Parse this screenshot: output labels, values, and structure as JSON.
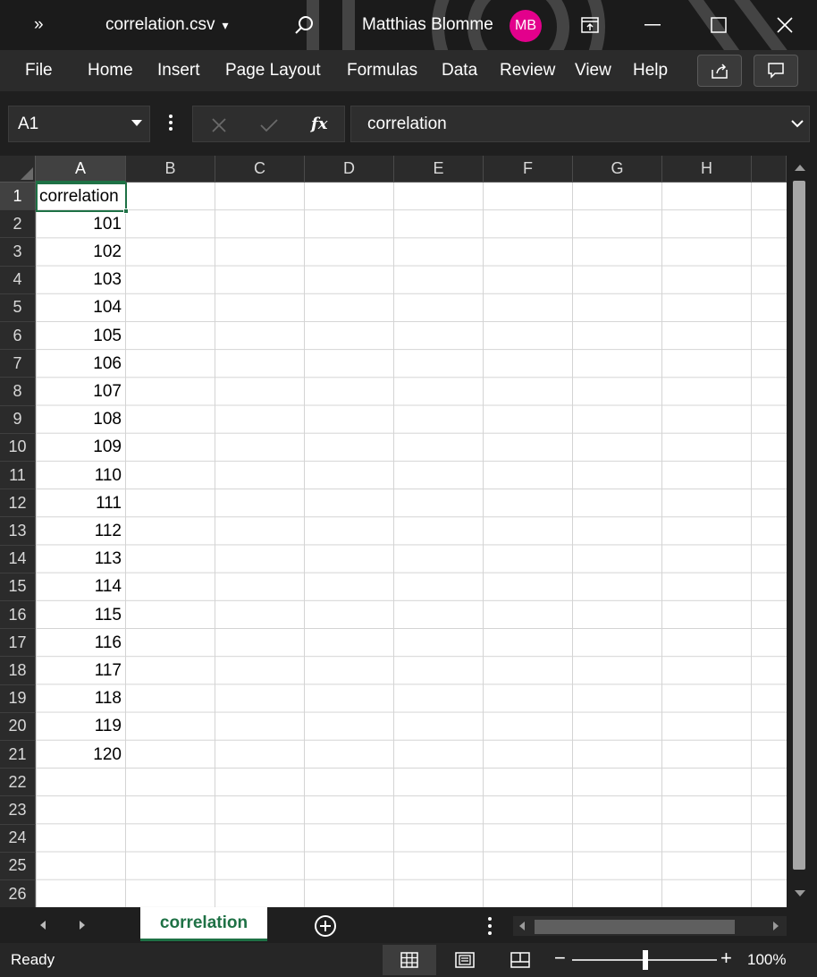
{
  "titlebar": {
    "overflow_label": "»",
    "file_name": "correlation.csv",
    "file_dropdown": "▾",
    "user_name": "Matthias Blomme",
    "user_initials": "MB"
  },
  "menu": {
    "items": [
      "File",
      "Home",
      "Insert",
      "Page Layout",
      "Formulas",
      "Data",
      "Review",
      "View",
      "Help"
    ]
  },
  "formula_bar": {
    "name_box": "A1",
    "fx_label": "fx",
    "content": "correlation"
  },
  "grid": {
    "columns": [
      "A",
      "B",
      "C",
      "D",
      "E",
      "F",
      "G",
      "H"
    ],
    "rows": [
      "1",
      "2",
      "3",
      "4",
      "5",
      "6",
      "7",
      "8",
      "9",
      "10",
      "11",
      "12",
      "13",
      "14",
      "15",
      "16",
      "17",
      "18",
      "19",
      "20",
      "21",
      "22",
      "23",
      "24",
      "25",
      "26"
    ],
    "column_a_values": [
      "correlation",
      "101",
      "102",
      "103",
      "104",
      "105",
      "106",
      "107",
      "108",
      "109",
      "110",
      "111",
      "112",
      "113",
      "114",
      "115",
      "116",
      "117",
      "118",
      "119",
      "120"
    ],
    "selected_cell": "A1"
  },
  "sheets": {
    "tabs": [
      "correlation"
    ],
    "active": "correlation"
  },
  "status": {
    "mode": "Ready",
    "zoom": "100%"
  },
  "colors": {
    "excel_green": "#1e7145",
    "avatar": "#e3008c"
  }
}
